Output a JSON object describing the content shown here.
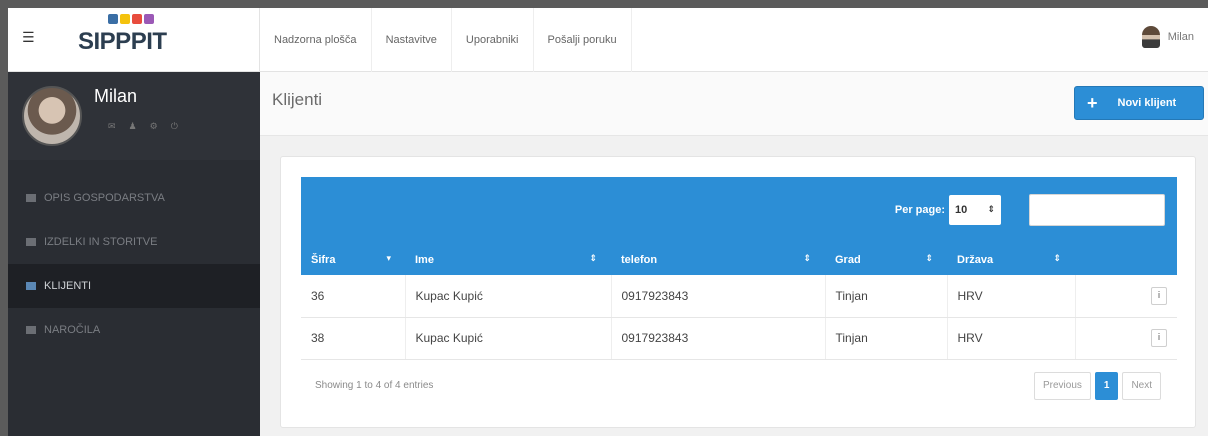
{
  "brand": {
    "menu_icon": "☰",
    "logo_text": "SIPPPIT",
    "logo_colors": [
      "#3a6ea5",
      "#f4c20d",
      "#e84c3d",
      "#9b59b6"
    ]
  },
  "topnav": {
    "items": [
      "Nadzorna plošča",
      "Nastavitve",
      "Uporabniki",
      "Pošalji poruku"
    ],
    "user": "Milan"
  },
  "sidebar": {
    "profile_name": "Milan",
    "items": [
      {
        "label": "OPIS GOSPODARSTVA"
      },
      {
        "label": "IZDELKI IN STORITVE"
      },
      {
        "label": "KLIJENTI",
        "active": true
      },
      {
        "label": "NAROČILA"
      }
    ]
  },
  "page": {
    "title": "Klijenti",
    "new_button": "Novi klijent",
    "new_button_icon": "+"
  },
  "table": {
    "per_page_label": "Per page:",
    "per_page_value": "10",
    "columns": [
      "Šifra",
      "Ime",
      "telefon",
      "Grad",
      "Država"
    ],
    "rows": [
      {
        "sifra": "36",
        "ime": "Kupac Kupić",
        "telefon": "0917923843",
        "grad": "Tinjan",
        "drzava": "HRV"
      },
      {
        "sifra": "38",
        "ime": "Kupac Kupić",
        "telefon": "0917923843",
        "grad": "Tinjan",
        "drzava": "HRV"
      }
    ],
    "showing": "Showing 1 to 4 of 4 entries",
    "pager": {
      "previous": "Previous",
      "current": "1",
      "next": "Next"
    }
  },
  "colors": {
    "accent": "#2c8ed6",
    "sidebar": "#2a2d33"
  }
}
